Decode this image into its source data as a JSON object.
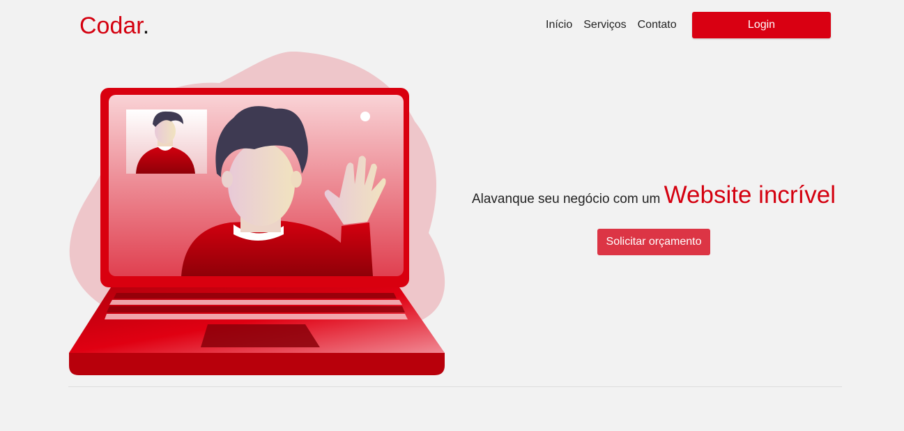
{
  "brand": {
    "name": "Codar",
    "dot": ".",
    "accent": "#d4000f"
  },
  "nav": {
    "items": [
      "Início",
      "Serviços",
      "Contato"
    ],
    "login_label": "Login"
  },
  "hero": {
    "headline_prefix": "Alavanque seu negócio com um",
    "headline_highlight": "Website incrível",
    "cta_label": "Solicitar orçamento",
    "cta_color": "#dc3545",
    "illustration": "laptop-video-call-illustration"
  }
}
